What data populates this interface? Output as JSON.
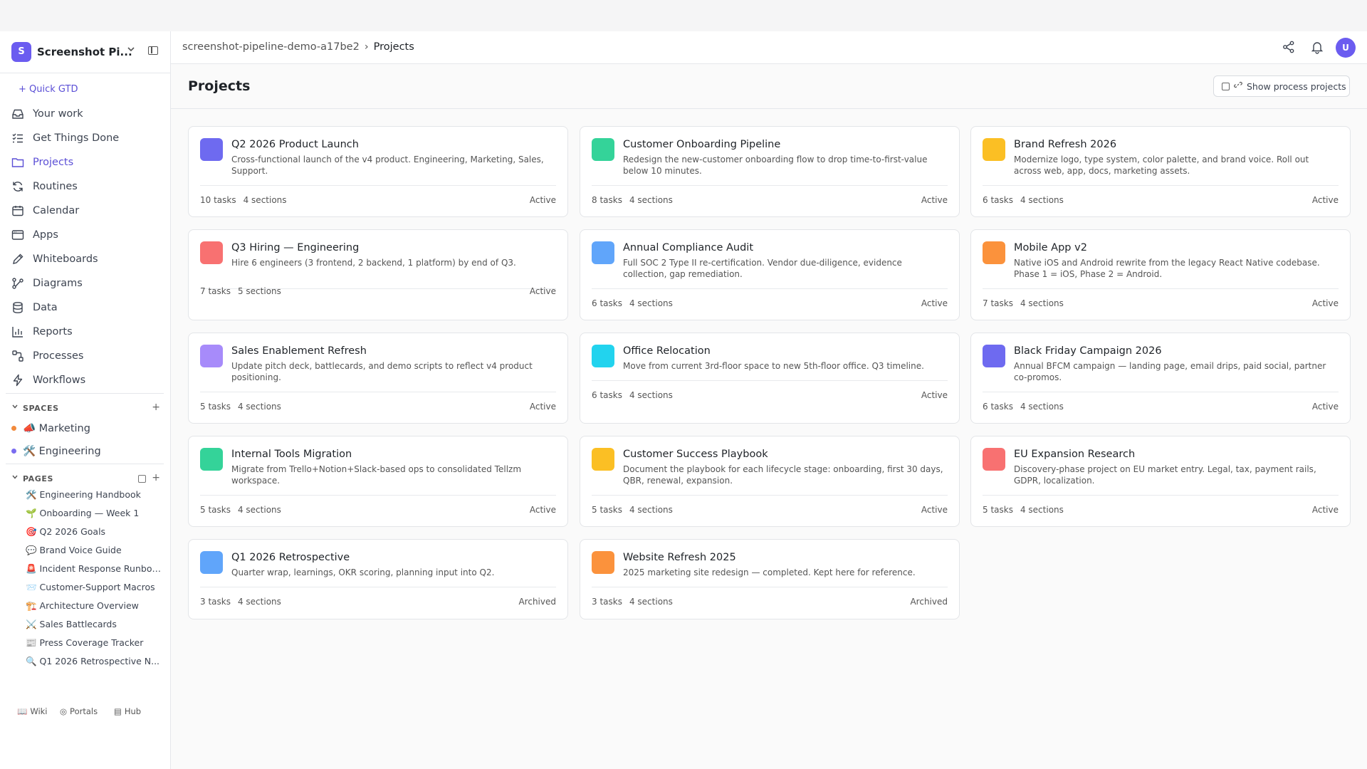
{
  "banner": {
    "message": "",
    "right": ""
  },
  "workspace": {
    "initial": "S",
    "name": "Screenshot Pi..."
  },
  "sidebar": {
    "quick_gtd": "+ Quick GTD",
    "nav": [
      {
        "label": "Your work",
        "icon": "inbox-icon"
      },
      {
        "label": "Get Things Done",
        "icon": "checklist-icon"
      },
      {
        "label": "Projects",
        "icon": "folder-icon",
        "active": true
      },
      {
        "label": "Routines",
        "icon": "refresh-icon"
      },
      {
        "label": "Calendar",
        "icon": "calendar-icon"
      },
      {
        "label": "Apps",
        "icon": "window-icon"
      },
      {
        "label": "Whiteboards",
        "icon": "pencil-icon"
      },
      {
        "label": "Diagrams",
        "icon": "diagram-icon"
      },
      {
        "label": "Data",
        "icon": "database-icon"
      },
      {
        "label": "Reports",
        "icon": "bar-chart-icon"
      },
      {
        "label": "Processes",
        "icon": "process-icon"
      },
      {
        "label": "Workflows",
        "icon": "lightning-icon"
      }
    ],
    "spaces_label": "SPACES",
    "spaces": [
      {
        "label": "📣 Marketing",
        "color": "#f28a3c"
      },
      {
        "label": "🛠️ Engineering",
        "color": "#7a6cf0"
      }
    ],
    "pages_label": "PAGES",
    "pages": [
      "🛠️ Engineering Handbook",
      "🌱 Onboarding — Week 1",
      "🎯 Q2 2026 Goals",
      "💬 Brand Voice Guide",
      "🚨 Incident Response Runbook",
      "📨 Customer-Support Macros",
      "🏗️ Architecture Overview",
      "⚔️ Sales Battlecards",
      "📰 Press Coverage Tracker",
      "🔍 Q1 2026 Retrospective N..."
    ],
    "footer": {
      "wiki": "Wiki",
      "portals": "Portals",
      "hub": "Hub"
    }
  },
  "header": {
    "breadcrumb_workspace": "screenshot-pipeline-demo-a17be2",
    "breadcrumb_current": "Projects",
    "avatar_initial": "U"
  },
  "page": {
    "title": "Projects",
    "show_process_label": "Show process projects"
  },
  "projects": [
    {
      "title": "Q2 2026 Product Launch",
      "desc": "Cross-functional launch of the v4 product. Engineering, Marketing, Sales, Support.",
      "tasks": "10 tasks",
      "sections": "4 sections",
      "status": "Active",
      "color": "#6e6af0"
    },
    {
      "title": "Customer Onboarding Pipeline",
      "desc": "Redesign the new-customer onboarding flow to drop time-to-first-value below 10 minutes.",
      "tasks": "8 tasks",
      "sections": "4 sections",
      "status": "Active",
      "color": "#34d399"
    },
    {
      "title": "Brand Refresh 2026",
      "desc": "Modernize logo, type system, color palette, and brand voice. Roll out across web, app, docs, marketing assets.",
      "tasks": "6 tasks",
      "sections": "4 sections",
      "status": "Active",
      "color": "#fbbf24"
    },
    {
      "title": "Q3 Hiring — Engineering",
      "desc": "Hire 6 engineers (3 frontend, 2 backend, 1 platform) by end of Q3.",
      "tasks": "7 tasks",
      "sections": "5 sections",
      "status": "Active",
      "color": "#f87171"
    },
    {
      "title": "Annual Compliance Audit",
      "desc": "Full SOC 2 Type II re-certification. Vendor due-diligence, evidence collection, gap remediation.",
      "tasks": "6 tasks",
      "sections": "4 sections",
      "status": "Active",
      "color": "#60a5fa"
    },
    {
      "title": "Mobile App v2",
      "desc": "Native iOS and Android rewrite from the legacy React Native codebase. Phase 1 = iOS, Phase 2 = Android.",
      "tasks": "7 tasks",
      "sections": "4 sections",
      "status": "Active",
      "color": "#fb923c"
    },
    {
      "title": "Sales Enablement Refresh",
      "desc": "Update pitch deck, battlecards, and demo scripts to reflect v4 product positioning.",
      "tasks": "5 tasks",
      "sections": "4 sections",
      "status": "Active",
      "color": "#a78bfa"
    },
    {
      "title": "Office Relocation",
      "desc": "Move from current 3rd-floor space to new 5th-floor office. Q3 timeline.",
      "tasks": "6 tasks",
      "sections": "4 sections",
      "status": "Active",
      "color": "#22d3ee"
    },
    {
      "title": "Black Friday Campaign 2026",
      "desc": "Annual BFCM campaign — landing page, email drips, paid social, partner co-promos.",
      "tasks": "6 tasks",
      "sections": "4 sections",
      "status": "Active",
      "color": "#6e6af0"
    },
    {
      "title": "Internal Tools Migration",
      "desc": "Migrate from Trello+Notion+Slack-based ops to consolidated Tellzm workspace.",
      "tasks": "5 tasks",
      "sections": "4 sections",
      "status": "Active",
      "color": "#34d399"
    },
    {
      "title": "Customer Success Playbook",
      "desc": "Document the playbook for each lifecycle stage: onboarding, first 30 days, QBR, renewal, expansion.",
      "tasks": "5 tasks",
      "sections": "4 sections",
      "status": "Active",
      "color": "#fbbf24"
    },
    {
      "title": "EU Expansion Research",
      "desc": "Discovery-phase project on EU market entry. Legal, tax, payment rails, GDPR, localization.",
      "tasks": "5 tasks",
      "sections": "4 sections",
      "status": "Active",
      "color": "#f87171"
    },
    {
      "title": "Q1 2026 Retrospective",
      "desc": "Quarter wrap, learnings, OKR scoring, planning input into Q2.",
      "tasks": "3 tasks",
      "sections": "4 sections",
      "status": "Archived",
      "color": "#60a5fa"
    },
    {
      "title": "Website Refresh 2025",
      "desc": "2025 marketing site redesign — completed. Kept here for reference.",
      "tasks": "3 tasks",
      "sections": "4 sections",
      "status": "Archived",
      "color": "#fb923c"
    }
  ]
}
